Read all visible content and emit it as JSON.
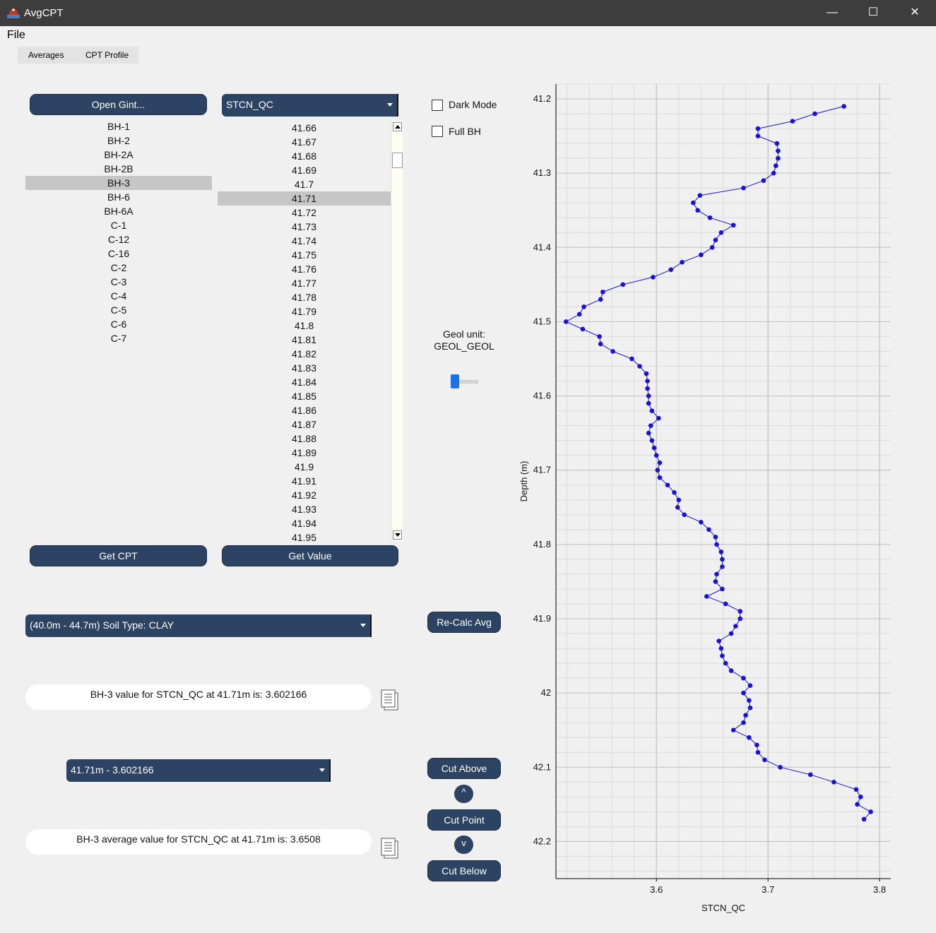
{
  "window": {
    "title": "AvgCPT",
    "minimize": "—",
    "maximize": "☐",
    "close": "✕"
  },
  "menu": {
    "file": "File"
  },
  "tabs": [
    {
      "label": "Averages"
    },
    {
      "label": "CPT Profile"
    }
  ],
  "buttons": {
    "open_gint": "Open Gint...",
    "get_cpt": "Get CPT",
    "get_value": "Get Value",
    "recalc_avg": "Re-Calc Avg",
    "cut_above": "Cut Above",
    "cut_point": "Cut Point",
    "cut_below": "Cut Below",
    "up": "^",
    "down": "v"
  },
  "parameter_select": {
    "value": "STCN_QC"
  },
  "boreholes": {
    "items": [
      "BH-1",
      "BH-2",
      "BH-2A",
      "BH-2B",
      "BH-3",
      "BH-6",
      "BH-6A",
      "C-1",
      "C-12",
      "C-16",
      "C-2",
      "C-3",
      "C-4",
      "C-5",
      "C-6",
      "C-7"
    ],
    "selected_index": 4
  },
  "depths": {
    "items": [
      "41.66",
      "41.67",
      "41.68",
      "41.69",
      "41.7",
      "41.71",
      "41.72",
      "41.73",
      "41.74",
      "41.75",
      "41.76",
      "41.77",
      "41.78",
      "41.79",
      "41.8",
      "41.81",
      "41.82",
      "41.83",
      "41.84",
      "41.85",
      "41.86",
      "41.87",
      "41.88",
      "41.89",
      "41.9",
      "41.91",
      "41.92",
      "41.93",
      "41.94",
      "41.95"
    ],
    "selected_index": 5
  },
  "options": {
    "dark_mode": "Dark Mode",
    "full_bh": "Full BH"
  },
  "geol": {
    "label": "Geol unit:",
    "value": "GEOL_GEOL"
  },
  "soil_select": {
    "value": "(40.0m -  44.7m) Soil Type: CLAY"
  },
  "value_message": "BH-3 value for STCN_QC at 41.71m is: 3.602166",
  "point_select": {
    "value": "41.71m - 3.602166"
  },
  "average_message": "BH-3 average value for STCN_QC at 41.71m is: 3.6508",
  "colors": {
    "button": "#2c4364",
    "accent": "#1a73e8",
    "series": "#1a10e0"
  },
  "chart_data": {
    "type": "line",
    "xlabel": "STCN_QC",
    "ylabel": "Depth (m)",
    "xlim": [
      3.51,
      3.81
    ],
    "ylim": [
      42.25,
      41.18
    ],
    "y_inverted": true,
    "grid": true,
    "xticks": [
      3.6,
      3.7,
      3.8
    ],
    "xtick_labels": [
      "3.6",
      "3.7",
      "3.8"
    ],
    "yticks": [
      41.2,
      41.3,
      41.4,
      41.5,
      41.6,
      41.7,
      41.8,
      41.9,
      42.0,
      42.1,
      42.2
    ],
    "ytick_labels": [
      "41.2",
      "41.3",
      "41.4",
      "41.5",
      "41.6",
      "41.7",
      "41.8",
      "41.9",
      "42",
      "42.1",
      "42.2"
    ],
    "series": [
      {
        "x": [
          3.768,
          3.742,
          3.722,
          3.691,
          3.691,
          3.708,
          3.709,
          3.709,
          3.707,
          3.705,
          3.696,
          3.678,
          3.639,
          3.633,
          3.637,
          3.648,
          3.669,
          3.658,
          3.653,
          3.65,
          3.64,
          3.623,
          3.613,
          3.597,
          3.57,
          3.552,
          3.55,
          3.535,
          3.531,
          3.519,
          3.534,
          3.549,
          3.55,
          3.561,
          3.578,
          3.585,
          3.591,
          3.592,
          3.592,
          3.593,
          3.593,
          3.596,
          3.602,
          3.595,
          3.593,
          3.596,
          3.598,
          3.6,
          3.603,
          3.601,
          3.603,
          3.61,
          3.616,
          3.62,
          3.619,
          3.625,
          3.64,
          3.647,
          3.653,
          3.654,
          3.658,
          3.659,
          3.659,
          3.654,
          3.653,
          3.659,
          3.645,
          3.662,
          3.675,
          3.675,
          3.671,
          3.667,
          3.656,
          3.658,
          3.659,
          3.662,
          3.667,
          3.678,
          3.684,
          3.678,
          3.683,
          3.684,
          3.68,
          3.678,
          3.669,
          3.683,
          3.69,
          3.691,
          3.697,
          3.711,
          3.738,
          3.759,
          3.779,
          3.783,
          3.78,
          3.792,
          3.786
        ],
        "y": [
          41.21,
          41.22,
          41.23,
          41.24,
          41.25,
          41.26,
          41.27,
          41.28,
          41.29,
          41.3,
          41.31,
          41.32,
          41.33,
          41.34,
          41.35,
          41.36,
          41.37,
          41.38,
          41.39,
          41.4,
          41.41,
          41.42,
          41.43,
          41.44,
          41.45,
          41.46,
          41.47,
          41.48,
          41.49,
          41.5,
          41.51,
          41.52,
          41.53,
          41.54,
          41.55,
          41.56,
          41.57,
          41.58,
          41.59,
          41.6,
          41.61,
          41.62,
          41.63,
          41.64,
          41.65,
          41.66,
          41.67,
          41.68,
          41.69,
          41.7,
          41.71,
          41.72,
          41.73,
          41.74,
          41.75,
          41.76,
          41.77,
          41.78,
          41.79,
          41.8,
          41.81,
          41.82,
          41.83,
          41.84,
          41.85,
          41.86,
          41.87,
          41.88,
          41.89,
          41.9,
          41.91,
          41.92,
          41.93,
          41.94,
          41.95,
          41.96,
          41.97,
          41.98,
          41.99,
          42.0,
          42.01,
          42.02,
          42.03,
          42.04,
          42.05,
          42.06,
          42.07,
          42.08,
          42.09,
          42.1,
          42.11,
          42.12,
          42.13,
          42.14,
          42.15,
          42.16,
          42.17
        ]
      }
    ]
  }
}
